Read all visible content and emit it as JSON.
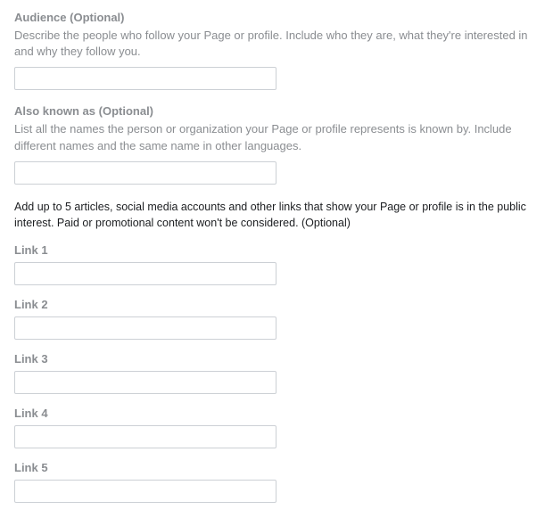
{
  "audience": {
    "heading": "Audience (Optional)",
    "description": "Describe the people who follow your Page or profile. Include who they are, what they're interested in and why they follow you.",
    "value": ""
  },
  "aka": {
    "heading": "Also known as (Optional)",
    "description": "List all the names the person or organization your Page or profile represents is known by. Include different names and the same name in other languages.",
    "value": ""
  },
  "links": {
    "intro": "Add up to 5 articles, social media accounts and other links that show your Page or profile is in the public interest. Paid or promotional content won't be considered. (Optional)",
    "items": [
      {
        "label": "Link 1",
        "value": ""
      },
      {
        "label": "Link 2",
        "value": ""
      },
      {
        "label": "Link 3",
        "value": ""
      },
      {
        "label": "Link 4",
        "value": ""
      },
      {
        "label": "Link 5",
        "value": ""
      }
    ]
  }
}
